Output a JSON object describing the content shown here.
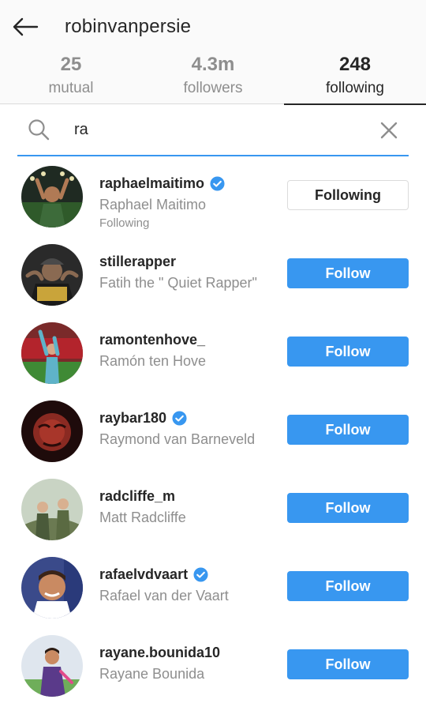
{
  "header": {
    "title": "robinvanpersie",
    "tabs": [
      {
        "count": "25",
        "label": "mutual"
      },
      {
        "count": "4.3m",
        "label": "followers"
      },
      {
        "count": "248",
        "label": "following"
      }
    ]
  },
  "search": {
    "value": "ra"
  },
  "icons": {
    "back": "arrow-left-icon",
    "search": "search-icon",
    "clear": "close-icon",
    "verified": "verified-badge-icon"
  },
  "colors": {
    "accent": "#3897f0",
    "text": "#262626",
    "muted": "#8e8e8e"
  },
  "users": [
    {
      "username": "raphaelmaitimo",
      "full_name": "Raphael Maitimo",
      "verified": true,
      "subtext": "Following",
      "button": "Following",
      "button_style": "following"
    },
    {
      "username": "stillerapper",
      "full_name": "Fatih the \" Quiet Rapper\"",
      "verified": false,
      "subtext": "",
      "button": "Follow",
      "button_style": "follow"
    },
    {
      "username": "ramontenhove_",
      "full_name": "Ramón ten Hove",
      "verified": false,
      "subtext": "",
      "button": "Follow",
      "button_style": "follow"
    },
    {
      "username": "raybar180",
      "full_name": "Raymond van Barneveld",
      "verified": true,
      "subtext": "",
      "button": "Follow",
      "button_style": "follow"
    },
    {
      "username": "radcliffe_m",
      "full_name": "Matt Radcliffe",
      "verified": false,
      "subtext": "",
      "button": "Follow",
      "button_style": "follow"
    },
    {
      "username": "rafaelvdvaart",
      "full_name": "Rafael van der Vaart",
      "verified": true,
      "subtext": "",
      "button": "Follow",
      "button_style": "follow"
    },
    {
      "username": "rayane.bounida10",
      "full_name": "Rayane Bounida",
      "verified": false,
      "subtext": "",
      "button": "Follow",
      "button_style": "follow"
    }
  ]
}
